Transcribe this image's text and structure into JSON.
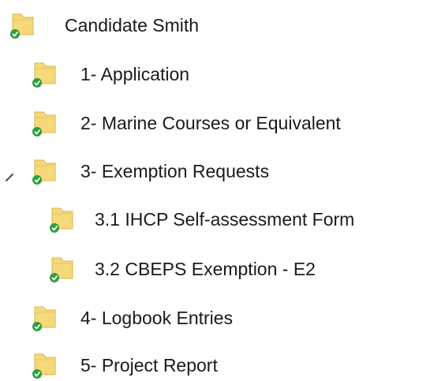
{
  "tree": {
    "root": {
      "label": "Candidate Smith",
      "icon": "synced-folder-icon"
    },
    "items": [
      {
        "label": "1- Application",
        "icon": "synced-folder-icon"
      },
      {
        "label": "2- Marine Courses or Equivalent",
        "icon": "synced-folder-icon"
      },
      {
        "label": "3- Exemption Requests",
        "icon": "synced-folder-icon",
        "expanded": true,
        "children": [
          {
            "label": "3.1 IHCP Self-assessment Form",
            "icon": "synced-folder-icon"
          },
          {
            "label": "3.2 CBEPS Exemption - E2",
            "icon": "synced-folder-icon"
          }
        ]
      },
      {
        "label": "4- Logbook Entries",
        "icon": "synced-folder-icon"
      },
      {
        "label": "5- Project Report",
        "icon": "synced-folder-icon"
      }
    ]
  },
  "colors": {
    "folder_fill": "#f5d97a",
    "folder_edge": "#d9b44a",
    "sync_check": "#2e9e3e",
    "text": "#1a1a1a"
  }
}
